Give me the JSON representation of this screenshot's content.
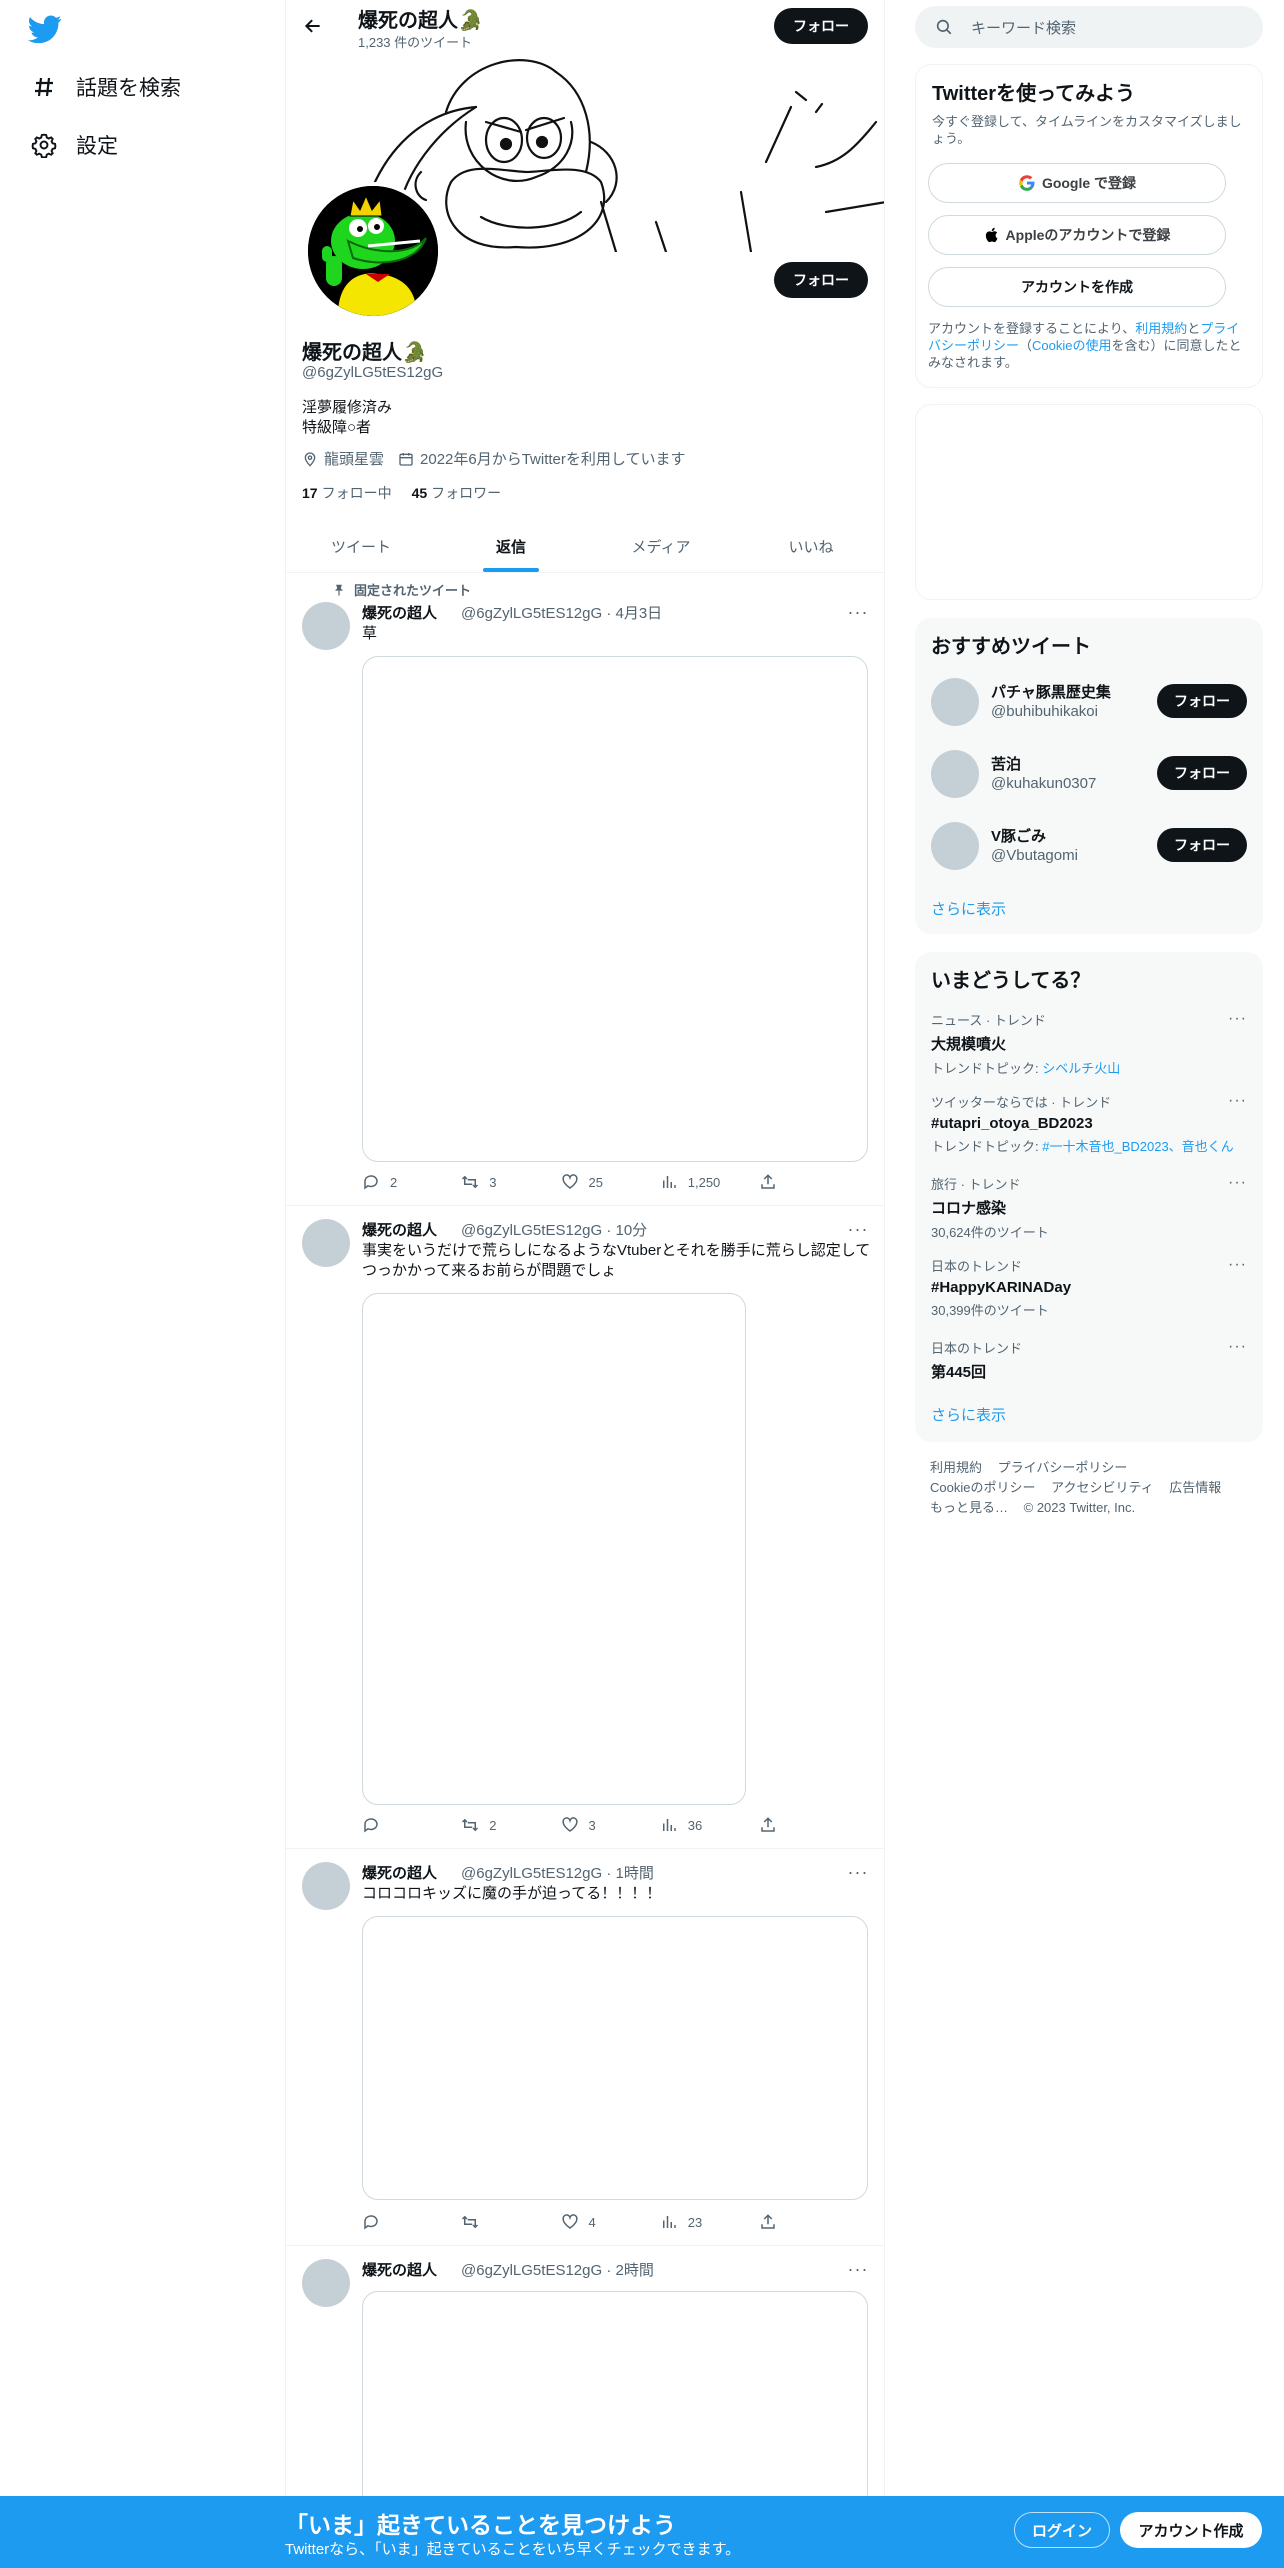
{
  "nav": {
    "items": [
      {
        "label": "話題を検索",
        "icon": "hashtag-icon"
      },
      {
        "label": "設定",
        "icon": "gear-icon"
      }
    ]
  },
  "header": {
    "name": "爆死の超人🐊",
    "tweet_count": "1,233 件のツイート",
    "follow_label": "フォロー"
  },
  "profile": {
    "follow_label": "フォロー",
    "name": "爆死の超人🐊",
    "handle": "@6gZylLG5tES12gG",
    "bio_lines": [
      "淫夢履修済み",
      "特級障○者"
    ],
    "location": "龍頭星雲",
    "joined": "2022年6月からTwitterを利用しています",
    "following_count": "17",
    "following_label": "フォロー中",
    "followers_count": "45",
    "followers_label": "フォロワー"
  },
  "tabs": [
    {
      "label": "ツイート",
      "active": false
    },
    {
      "label": "返信",
      "active": true
    },
    {
      "label": "メディア",
      "active": false
    },
    {
      "label": "いいね",
      "active": false
    }
  ],
  "tweets": [
    {
      "pinned_label": "固定されたツイート",
      "name": "爆死の超人",
      "handle": "@6gZylLG5tES12gG · 4月3日",
      "text": "草",
      "replies": "2",
      "retweets": "3",
      "likes": "25",
      "views": "1,250"
    },
    {
      "name": "爆死の超人",
      "handle": "@6gZylLG5tES12gG · 10分",
      "text": "事実をいうだけで荒らしになるようなVtuberとそれを勝手に荒らし認定してつっかかって来るお前らが問題でしょ",
      "replies": "",
      "retweets": "2",
      "likes": "3",
      "views": "36"
    },
    {
      "name": "爆死の超人",
      "handle": "@6gZylLG5tES12gG · 1時間",
      "text": "コロコロキッズに魔の手が迫ってる！！！！",
      "replies": "",
      "retweets": "",
      "likes": "4",
      "views": "23"
    },
    {
      "name": "爆死の超人",
      "handle": "@6gZylLG5tES12gG · 2時間",
      "text": ""
    }
  ],
  "search": {
    "placeholder": "キーワード検索"
  },
  "join": {
    "title": "Twitterを使ってみよう",
    "subtitle": "今すぐ登録して、タイムラインをカスタマイズしましょう。",
    "google_label": "Google で登録",
    "apple_label": "Appleのアカウントで登録",
    "create_label": "アカウントを作成",
    "legal_prefix": "アカウントを登録することにより、",
    "legal_terms": "利用規約",
    "legal_and": "と",
    "legal_privacy": "プライバシーポリシー",
    "legal_open": "（",
    "legal_cookie": "Cookieの使用",
    "legal_suffix": "を含む）に同意したとみなされます。"
  },
  "recommend": {
    "title": "おすすめツイート",
    "users": [
      {
        "name": "パチャ豚黒歴史集",
        "handle": "@buhibuhikakoi",
        "follow_label": "フォロー"
      },
      {
        "name": "苦泊",
        "handle": "@kuhakun0307",
        "follow_label": "フォロー"
      },
      {
        "name": "V豚ごみ",
        "handle": "@Vbutagomi",
        "follow_label": "フォロー"
      }
    ],
    "show_more": "さらに表示"
  },
  "trends": {
    "title": "いまどうしてる？",
    "items": [
      {
        "context": "ニュース · トレンド",
        "title": "大規模噴火",
        "sub_prefix": "トレンドトピック: ",
        "sub_link": "シベルチ火山"
      },
      {
        "context": "ツイッターならでは · トレンド",
        "title": "#utapri_otoya_BD2023",
        "sub_prefix": "トレンドトピック: ",
        "sub_link": "#一十木音也_BD2023、音也くん"
      },
      {
        "context": "旅行 · トレンド",
        "title": "コロナ感染",
        "sub_prefix": "30,624件のツイート",
        "sub_link": ""
      },
      {
        "context": "日本のトレンド",
        "title": "#HappyKARINADay",
        "sub_prefix": "30,399件のツイート",
        "sub_link": ""
      },
      {
        "context": "日本のトレンド",
        "title": "第445回",
        "sub_prefix": "",
        "sub_link": ""
      }
    ],
    "show_more": "さらに表示"
  },
  "footer": {
    "links": [
      "利用規約",
      "プライバシーポリシー",
      "Cookieのポリシー",
      "アクセシビリティ",
      "広告情報",
      "もっと見る…",
      "© 2023 Twitter, Inc."
    ]
  },
  "bottom": {
    "title": "「いま」起きていることを見つけよう",
    "subtitle": "Twitterなら、「いま」起きていることをいち早くチェックできます。",
    "login_label": "ログイン",
    "signup_label": "アカウント作成"
  },
  "colors": {
    "accent": "#1d9bf0",
    "text": "#0f1419",
    "muted": "#536471",
    "bar": "#1d9bf0"
  }
}
